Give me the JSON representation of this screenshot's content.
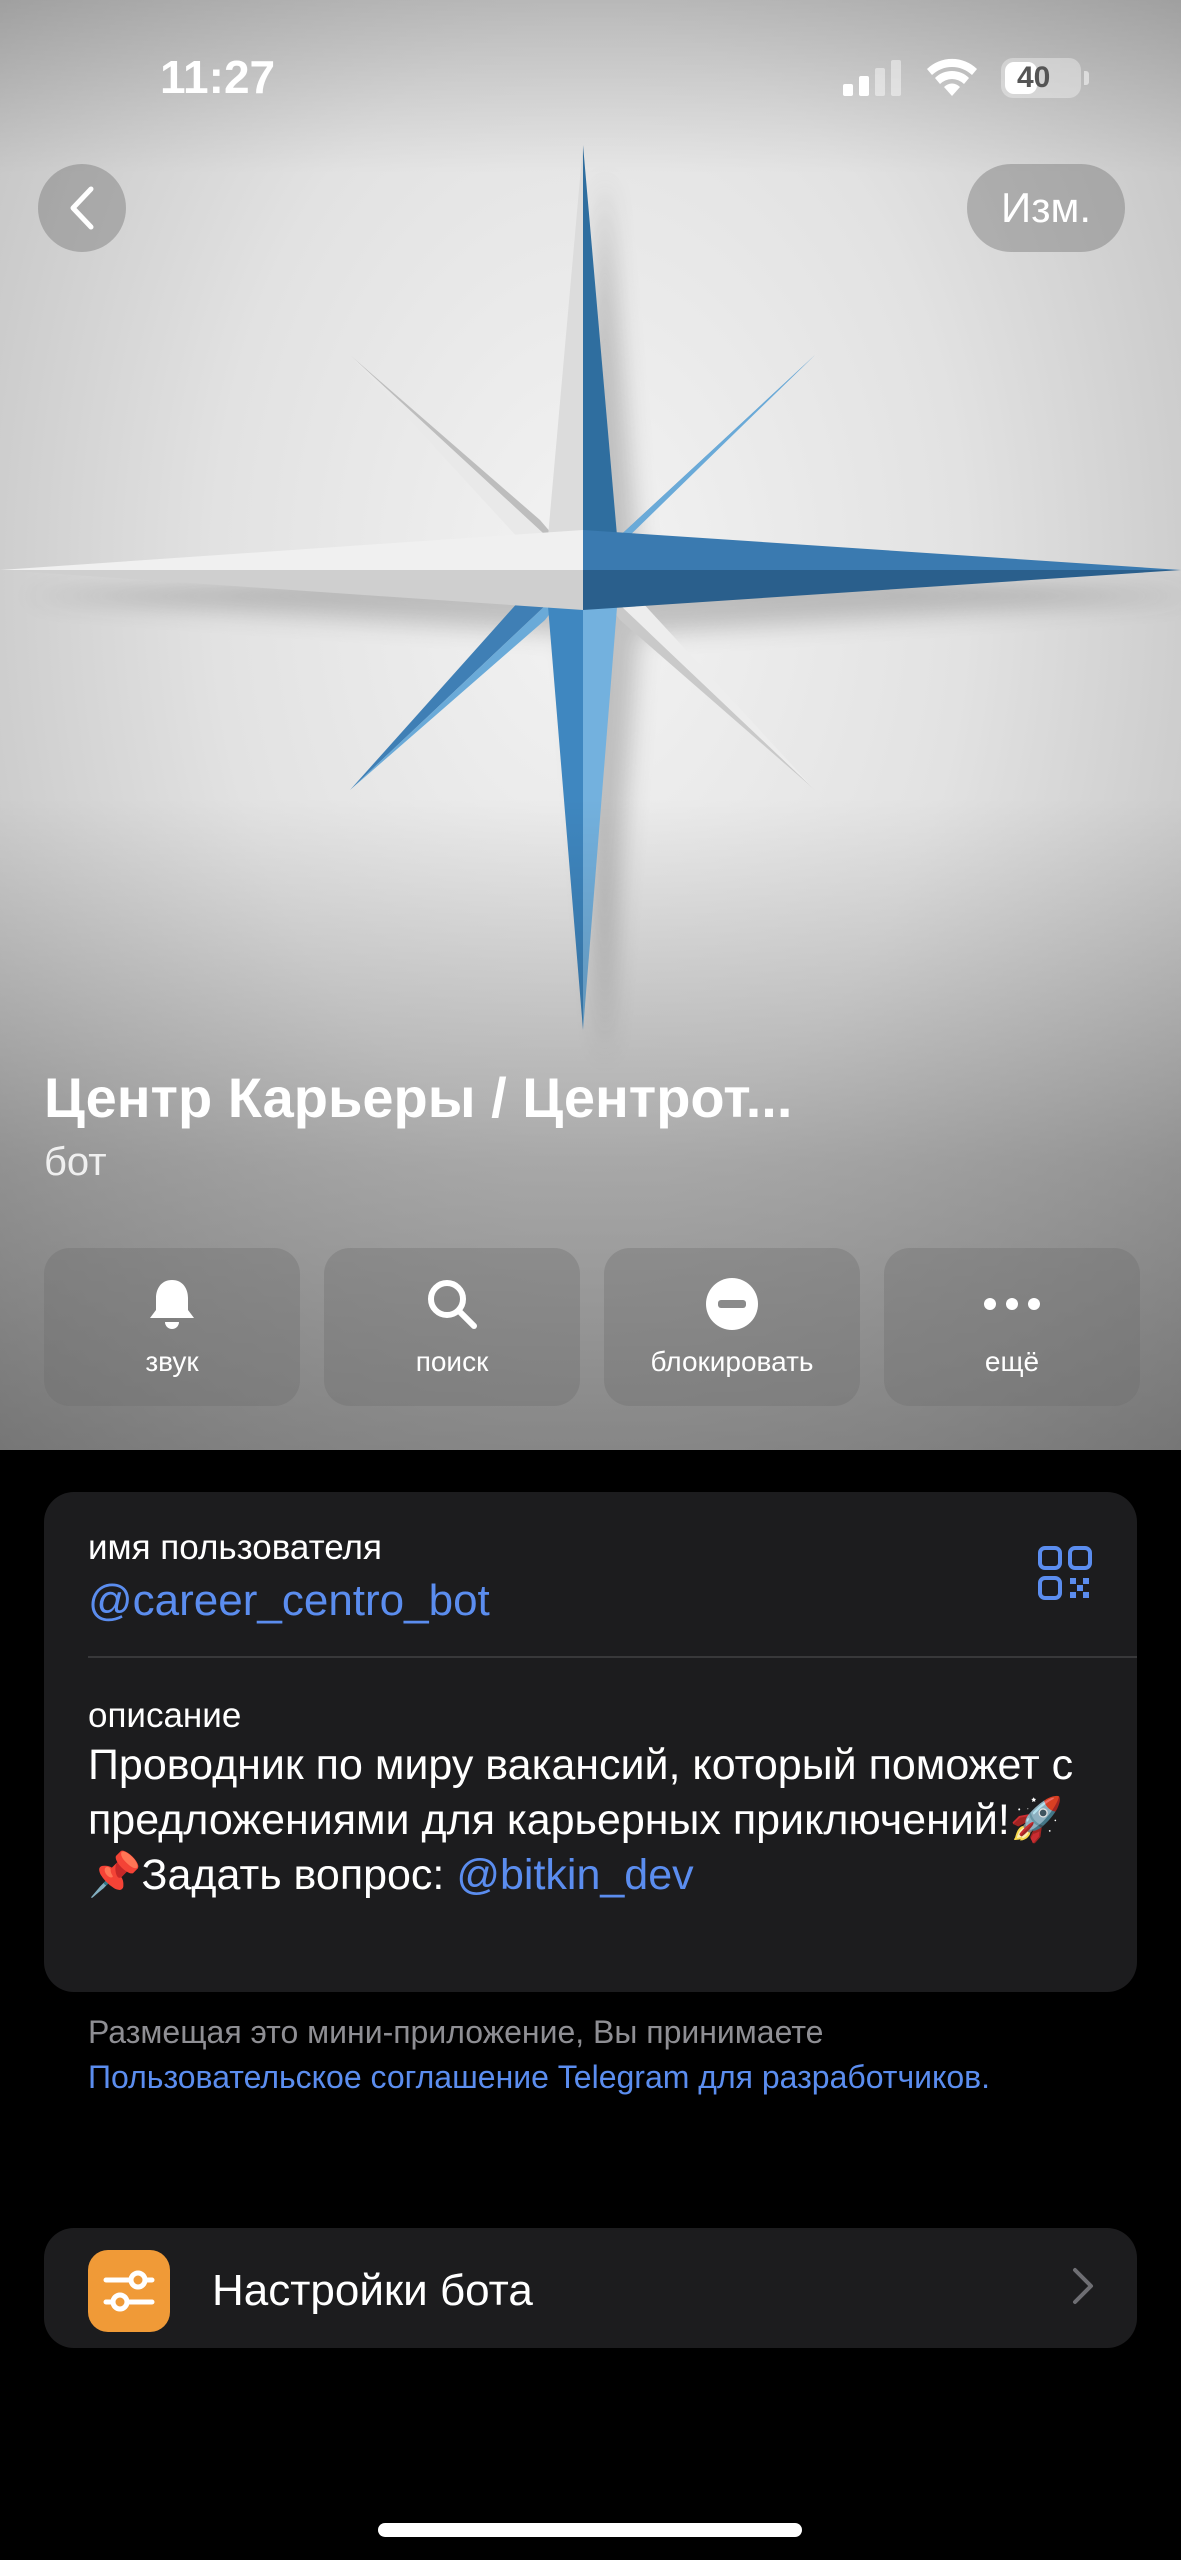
{
  "status_bar": {
    "time": "11:27",
    "battery": "40"
  },
  "header": {
    "back_icon": "chevron-left-icon",
    "edit_label": "Изм."
  },
  "profile": {
    "name": "Центр Карьеры / Центрот...",
    "type": "бот"
  },
  "actions": [
    {
      "icon": "bell-icon",
      "label": "звук"
    },
    {
      "icon": "search-icon",
      "label": "поиск"
    },
    {
      "icon": "block-icon",
      "label": "блокировать"
    },
    {
      "icon": "more-icon",
      "label": "ещё"
    }
  ],
  "info": {
    "username_label": "имя пользователя",
    "username": "@career_centro_bot",
    "description_label": "описание",
    "description_line1": "Проводник по миру вакансий, который поможет с предложениями для карьерных приключений!",
    "rocket": "🚀",
    "pin": "📌",
    "ask_text": "Задать вопрос: ",
    "ask_link": "@bitkin_dev"
  },
  "footnote": {
    "text": "Размещая это мини-приложение, Вы принимаете ",
    "link": "Пользовательское соглашение Telegram для разработчиков."
  },
  "settings": {
    "label": "Настройки бота",
    "icon": "sliders-icon"
  },
  "colors": {
    "accent": "#5b8def",
    "settings_icon_bg": "#f09a37",
    "card_bg": "#1c1c1e"
  }
}
